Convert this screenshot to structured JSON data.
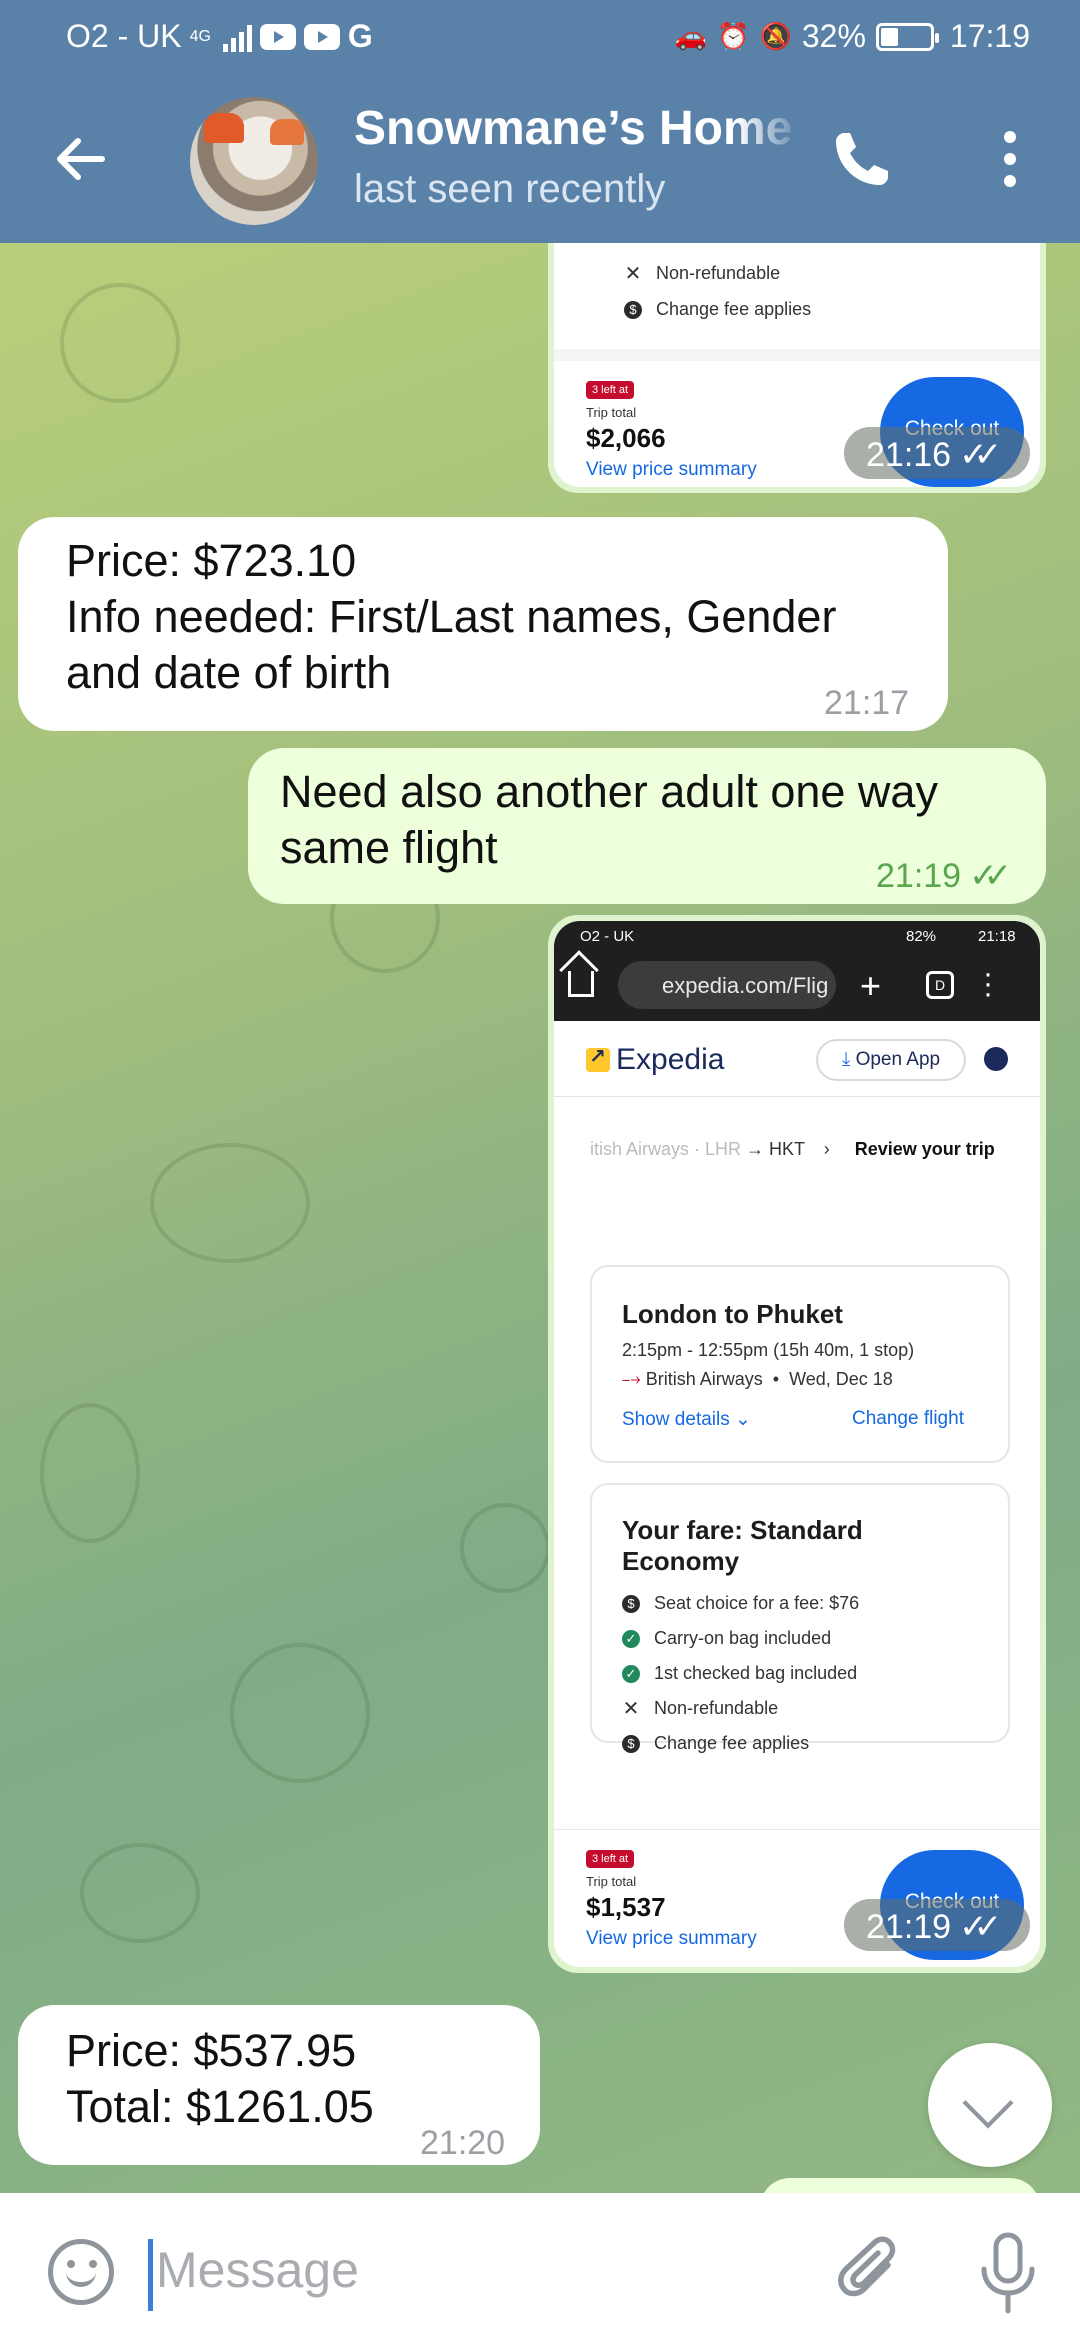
{
  "status_bar": {
    "carrier": "O2 - UK",
    "network": "4G",
    "battery": "32%",
    "battery_level": 0.32,
    "time": "17:19"
  },
  "header": {
    "contact_name": "Snowmane’s Home",
    "status": "last seen recently"
  },
  "messages": {
    "card1": {
      "features": [
        "Non-refundable",
        "Change fee applies"
      ],
      "badge": "3 left at",
      "trip_total_label": "Trip total",
      "trip_total": "$2,066",
      "price_link": "View price summary",
      "checkout": "Check out",
      "time": "21:16"
    },
    "msg_price1": {
      "lines": [
        "Price: $723.10",
        "Info needed: First/Last names, Gender",
        "and date of birth"
      ],
      "time": "21:17"
    },
    "msg_out": {
      "lines": [
        "Need also another adult one way",
        "same flight"
      ],
      "time": "21:19"
    },
    "card2": {
      "phone_status": {
        "carrier": "O2 - UK",
        "battery": "82%",
        "time": "21:18"
      },
      "url": "expedia.com/Flig",
      "brand": "Expedia",
      "open_app": "Open App",
      "breadcrumb_faded": "itish Airways · LHR",
      "breadcrumb_route": "→ HKT",
      "breadcrumb_current": "Review your trip",
      "flight": {
        "title": "London to Phuket",
        "times": "2:15pm - 12:55pm (15h 40m, 1 stop)",
        "airline": "British Airways",
        "date": "Wed, Dec 18",
        "show_details": "Show details",
        "change_flight": "Change flight"
      },
      "fare": {
        "title_line1": "Your fare: Standard",
        "title_line2": "Economy",
        "features": [
          {
            "icon": "dollar-icon",
            "text": "Seat choice for a fee: $76"
          },
          {
            "icon": "check-icon",
            "text": "Carry-on bag included"
          },
          {
            "icon": "check-icon",
            "text": "1st checked bag included"
          },
          {
            "icon": "x-icon",
            "text": "Non-refundable"
          },
          {
            "icon": "dollar-icon",
            "text": "Change fee applies"
          }
        ]
      },
      "badge": "3 left at",
      "trip_total_label": "Trip total",
      "trip_total": "$1,537",
      "price_link": "View price summary",
      "checkout": "Check out",
      "time": "21:19"
    },
    "msg_price2": {
      "lines": [
        "Price: $537.95",
        "Total: $1261.05"
      ],
      "time": "21:20"
    }
  },
  "input": {
    "placeholder": "Message"
  },
  "colors": {
    "header": "#5a82a8",
    "outgoing_bubble": "#eeffdc",
    "incoming_bubble": "#ffffff",
    "read_check": "#5aa64e",
    "expedia_blue": "#1668e3"
  }
}
